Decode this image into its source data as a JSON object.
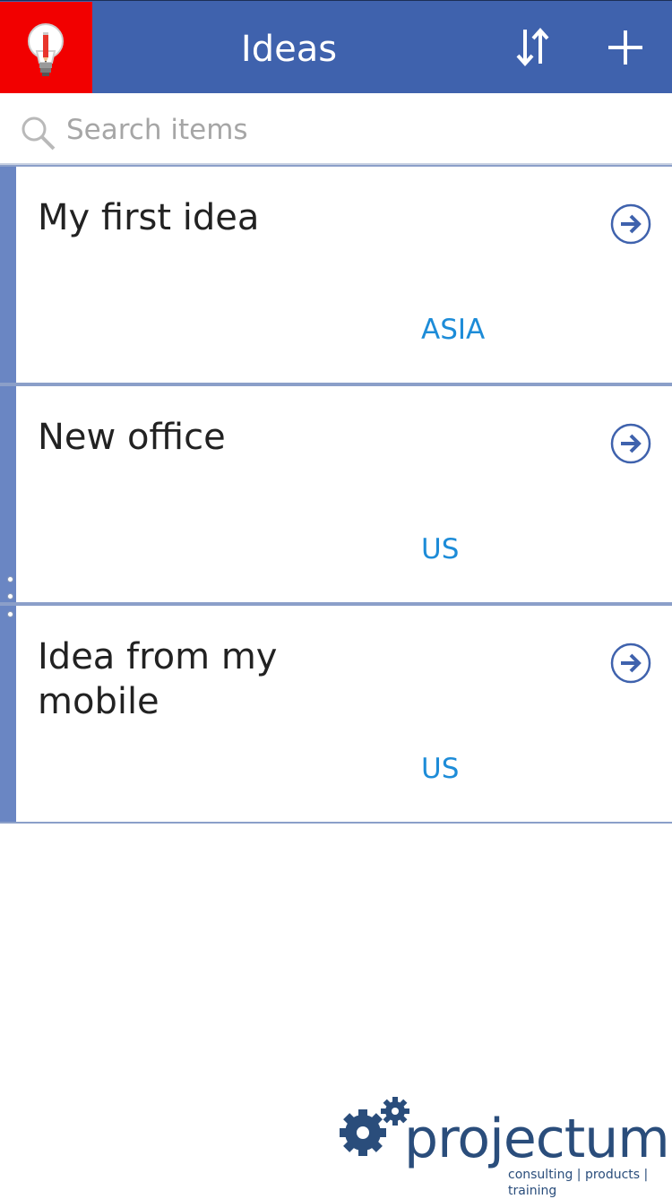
{
  "header": {
    "title": "Ideas",
    "logo_icon": "lightbulb-icon",
    "sort_icon": "sort-icon",
    "add_icon": "plus-icon",
    "colors": {
      "bar": "#3f62ad",
      "logo_bg": "#f20000"
    }
  },
  "search": {
    "placeholder": "Search items",
    "value": ""
  },
  "items": [
    {
      "title": "My first idea",
      "region": "ASIA"
    },
    {
      "title": "New office",
      "region": "US"
    },
    {
      "title": "Idea from my mobile",
      "region": "US"
    }
  ],
  "item_colors": {
    "accent": "#6a86c3",
    "region_text": "#1d8cd8"
  },
  "brand": {
    "name": "projectum",
    "tagline": "consulting | products | training"
  }
}
